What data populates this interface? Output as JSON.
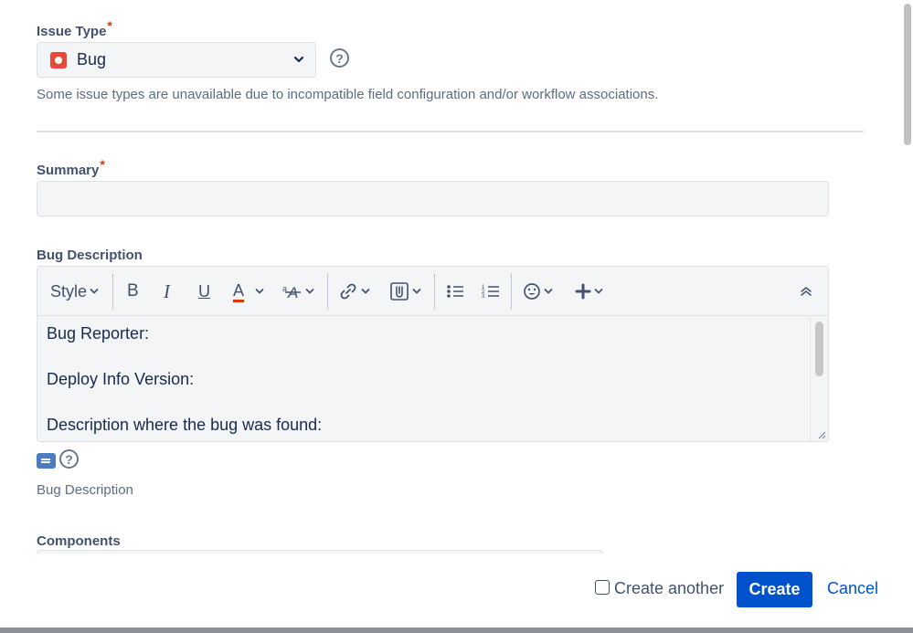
{
  "issue_type": {
    "label": "Issue Type",
    "required_mark": "*",
    "selected": "Bug",
    "hint": "Some issue types are unavailable due to incompatible field configuration and/or workflow associations."
  },
  "summary": {
    "label": "Summary",
    "required_mark": "*",
    "value": ""
  },
  "description": {
    "label": "Bug Description",
    "toolbar": {
      "style_label": "Style",
      "bold": "B",
      "italic": "I",
      "underline": "U",
      "text_color": "A",
      "text_color_value": "#de350b"
    },
    "lines": [
      "Bug Reporter:",
      "Deploy Info Version:",
      "Description where the bug was found:"
    ],
    "help_text": "Bug Description"
  },
  "components": {
    "label": "Components"
  },
  "footer": {
    "create_another_label": "Create another",
    "create_another_checked": false,
    "create_label": "Create",
    "cancel_label": "Cancel"
  },
  "help_mark": "?"
}
